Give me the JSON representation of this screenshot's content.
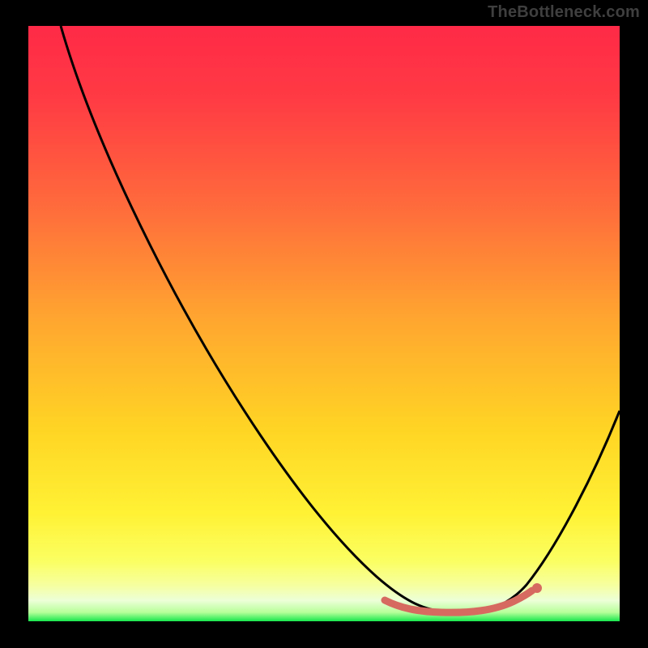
{
  "watermark": "TheBottleneck.com",
  "colors": {
    "background": "#000000",
    "gradient_top": "#ff2a47",
    "gradient_mid": "#ffd524",
    "gradient_bottom": "#17e74d",
    "curve": "#000000",
    "highlight": "#d66a60"
  },
  "chart_data": {
    "type": "line",
    "title": "",
    "xlabel": "",
    "ylabel": "",
    "xlim": [
      0,
      100
    ],
    "ylim": [
      0,
      100
    ],
    "grid": false,
    "series": [
      {
        "name": "bottleneck_curve",
        "x": [
          6,
          10,
          15,
          20,
          25,
          30,
          35,
          40,
          45,
          50,
          55,
          60,
          63,
          67,
          70,
          73,
          77,
          82,
          86,
          90,
          95,
          100
        ],
        "values": [
          100,
          94,
          86,
          77,
          68,
          59,
          50,
          42,
          34,
          26,
          19,
          12,
          8,
          4,
          2,
          1.5,
          1.5,
          3,
          6,
          12,
          22,
          35
        ]
      }
    ],
    "annotations": [
      {
        "name": "optimal_zone",
        "x_range": [
          60,
          86
        ],
        "y": 2,
        "marker_x": 86,
        "marker_y": 5
      }
    ]
  }
}
